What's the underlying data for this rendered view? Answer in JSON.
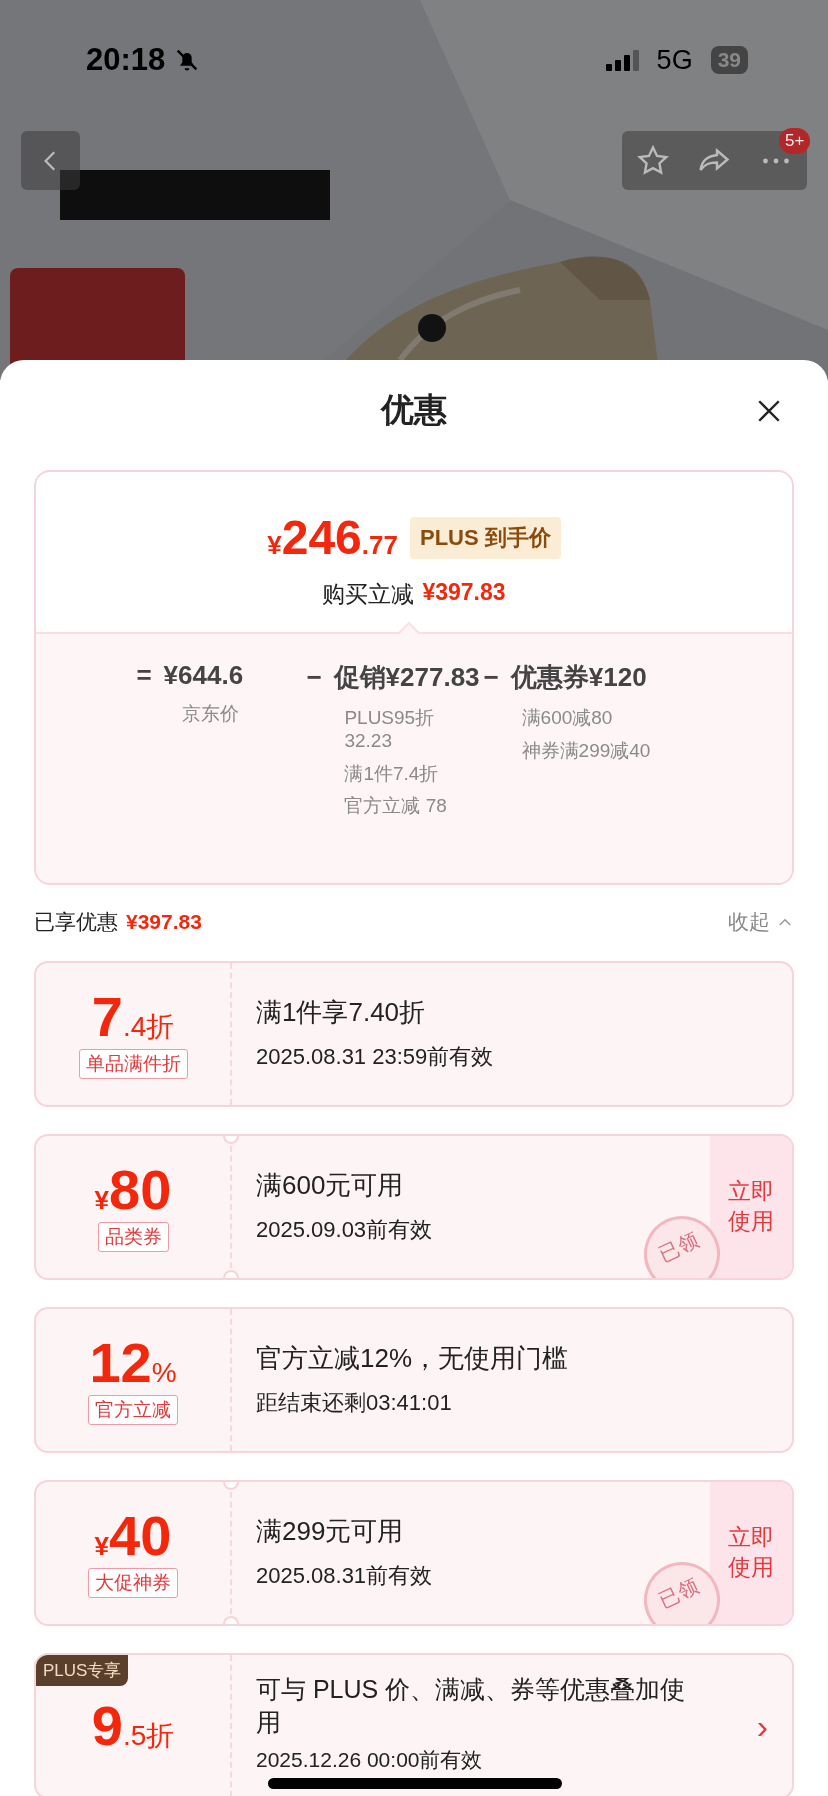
{
  "status_bar": {
    "time": "20:18",
    "network": "5G",
    "battery": "39"
  },
  "nav": {
    "more_badge": "5+"
  },
  "sheet": {
    "title": "优惠"
  },
  "summary": {
    "currency": "¥",
    "price_int": "246",
    "price_dec": ".77",
    "plus_tag": "PLUS 到手价",
    "saving_label": "购买立减",
    "saving_value": "¥397.83",
    "terms": [
      {
        "op": "=",
        "amount": "¥644.6",
        "notes": [
          "京东价"
        ]
      },
      {
        "op": "−",
        "amount": "促销¥277.83",
        "notes": [
          "PLUS95折 32.23",
          "满1件7.4折",
          "官方立减 78"
        ]
      },
      {
        "op": "−",
        "amount": "优惠券¥120",
        "notes": [
          "满600减80",
          "神券满299减40"
        ]
      }
    ]
  },
  "applied": {
    "label": "已享优惠",
    "value": "¥397.83",
    "toggle": "收起",
    "expanded": true
  },
  "coupons": [
    {
      "kind": "discount",
      "value": "7",
      "suffix": ".4折",
      "tag": "单品满件折",
      "title": "满1件享7.40折",
      "subtitle": "2025.08.31 23:59前有效"
    },
    {
      "kind": "coupon",
      "prefix": "¥",
      "value": "80",
      "tag": "品类券",
      "title": "满600元可用",
      "subtitle": "2025.09.03前有效",
      "action": "立即使用",
      "stamp": "已领"
    },
    {
      "kind": "discount",
      "value": "12",
      "suffix": "%",
      "tag": "官方立减",
      "title": "官方立减12%，无使用门槛",
      "subtitle": "距结束还剩03:41:01"
    },
    {
      "kind": "coupon",
      "prefix": "¥",
      "value": "40",
      "tag": "大促神券",
      "title": "满299元可用",
      "subtitle": "2025.08.31前有效",
      "action": "立即使用",
      "stamp": "已领"
    },
    {
      "kind": "plus",
      "corner": "PLUS专享",
      "value": "9",
      "suffix": ".5折",
      "title": "可与 PLUS 价、满减、券等优惠叠加使用",
      "subtitle": "2025.12.26 00:00前有效",
      "chevron": "›"
    }
  ]
}
